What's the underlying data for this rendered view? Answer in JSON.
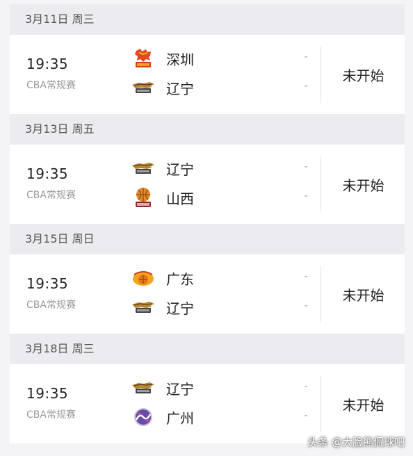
{
  "days": [
    {
      "date": "3月11日 周三",
      "time": "19:35",
      "league": "CBA常规赛",
      "team1": {
        "name": "深圳",
        "logo": "shenzhen-tiger-logo-icon"
      },
      "team2": {
        "name": "辽宁",
        "logo": "liaoning-flying-leopards-logo-icon"
      },
      "score1": "-",
      "score2": "-",
      "status": "未开始"
    },
    {
      "date": "3月13日 周五",
      "time": "19:35",
      "league": "CBA常规赛",
      "team1": {
        "name": "辽宁",
        "logo": "liaoning-flying-leopards-logo-icon"
      },
      "team2": {
        "name": "山西",
        "logo": "shanxi-basketball-logo-icon"
      },
      "score1": "-",
      "score2": "-",
      "status": "未开始"
    },
    {
      "date": "3月15日 周日",
      "time": "19:35",
      "league": "CBA常规赛",
      "team1": {
        "name": "广东",
        "logo": "guangdong-tigers-logo-icon"
      },
      "team2": {
        "name": "辽宁",
        "logo": "liaoning-flying-leopards-logo-icon"
      },
      "score1": "-",
      "score2": "-",
      "status": "未开始"
    },
    {
      "date": "3月18日 周三",
      "time": "19:35",
      "league": "CBA常规赛",
      "team1": {
        "name": "辽宁",
        "logo": "liaoning-flying-leopards-logo-icon"
      },
      "team2": {
        "name": "广州",
        "logo": "guangzhou-loong-lions-logo-icon"
      },
      "score1": "-",
      "score2": "-",
      "status": "未开始"
    }
  ],
  "watermark": "头条 @大脸熊侃球吧"
}
